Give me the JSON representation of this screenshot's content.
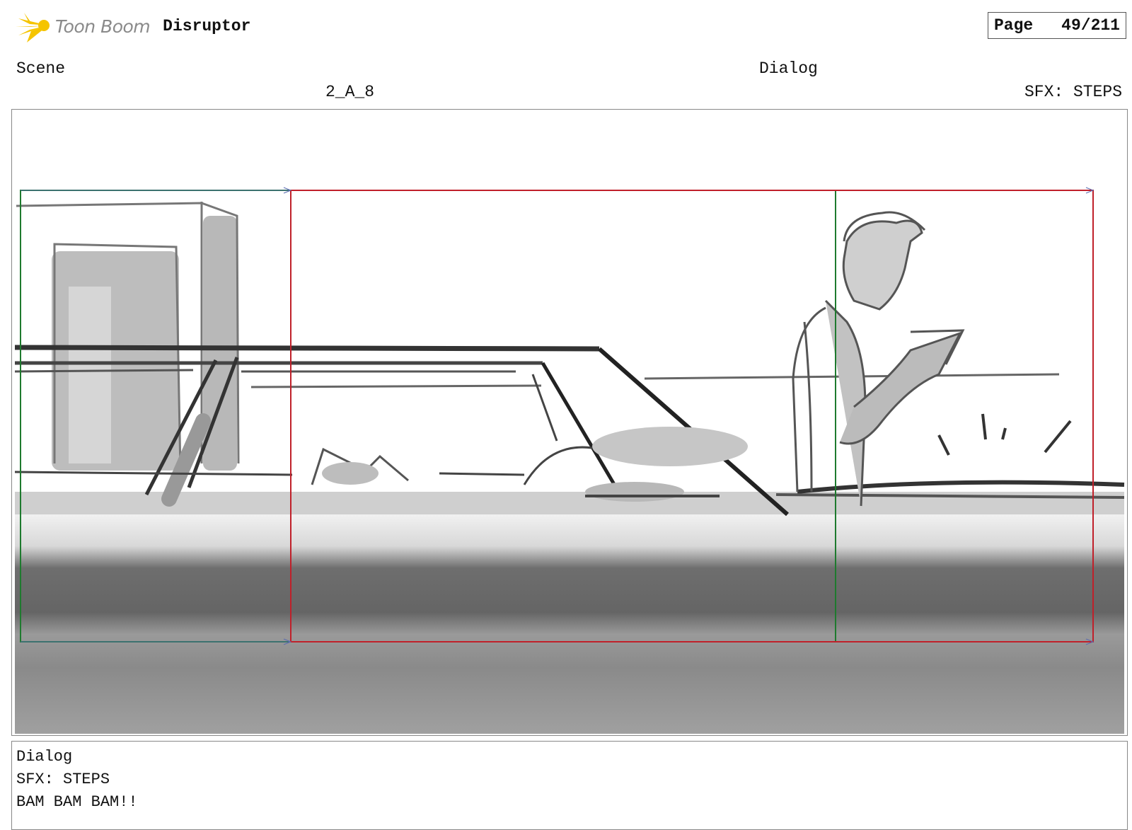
{
  "header": {
    "brand": "Toon Boom",
    "product": "Disruptor",
    "page_label": "Page",
    "page_value": "49/211"
  },
  "scene": {
    "label": "Scene",
    "value": "2_A_8"
  },
  "dialog_header": {
    "label": "Dialog",
    "value": "SFX: STEPS"
  },
  "dialog_panel": {
    "title": "Dialog",
    "lines": [
      "SFX: STEPS",
      "BAM BAM BAM!!"
    ]
  },
  "colors": {
    "logo_star": "#f5c400",
    "guide_green": "#1e7a2e",
    "guide_red": "#c0202a",
    "road_dark": "#6a6a6a",
    "road_mid": "#8c8c8c"
  }
}
